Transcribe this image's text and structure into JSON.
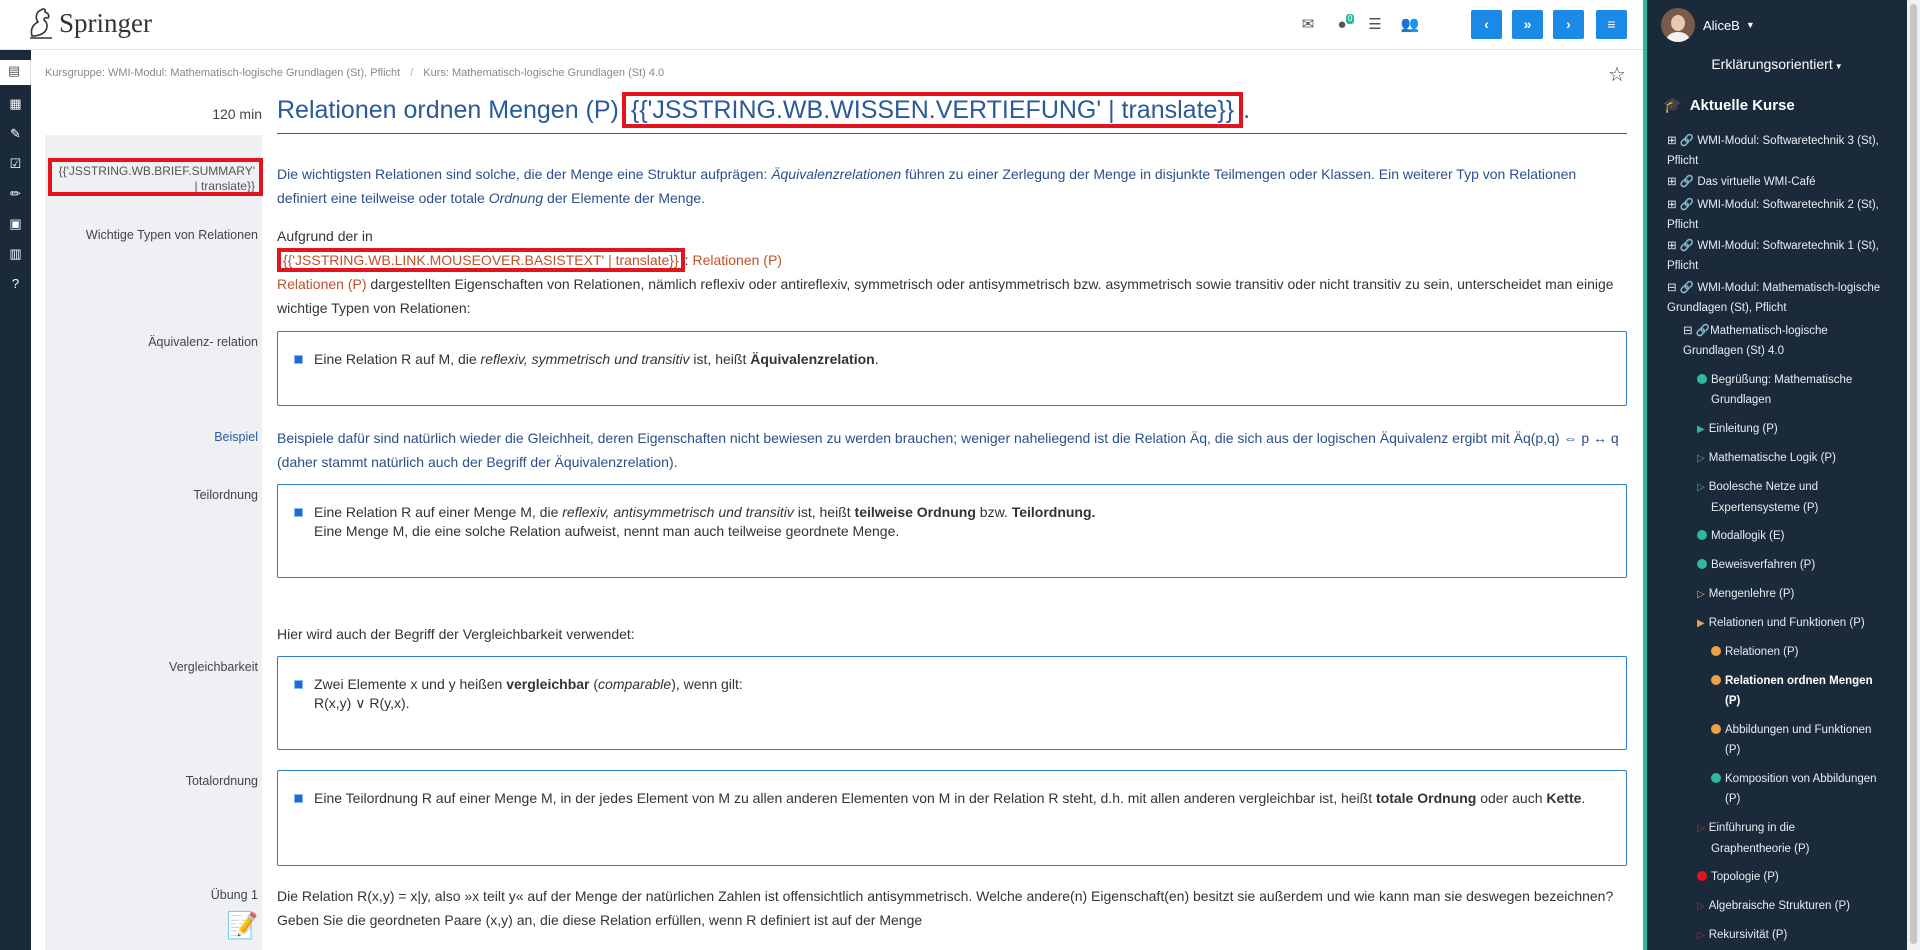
{
  "header": {
    "logo_text": "Springer",
    "badge_count": "0",
    "nav_prev": "‹",
    "nav_down": "»",
    "nav_next": "›",
    "nav_menu": "≡"
  },
  "breadcrumb": {
    "item1": "Kursgruppe: WMI-Modul: Mathematisch-logische Grundlagen (St), Pflicht",
    "item2": "Kurs: Mathematisch-logische Grundlagen (St) 4.0"
  },
  "page": {
    "duration": "120 min",
    "title": "Relationen ordnen Mengen (P)",
    "title_placeholder": "{{'JSSTRING.WB.WISSEN.VERTIEFUNG' | translate}}",
    "title_period": ".",
    "summary_placeholder": "{{'JSSTRING.WB.BRIEF.SUMMARY' | translate}}",
    "intro_a": "Die wichtigsten Relationen sind solche, die der Menge eine Struktur aufprägen: ",
    "intro_em1": "Äquivalenzrelationen",
    "intro_b": " führen zu einer Zerlegung der Menge in disjunkte Teilmengen oder Klassen. Ein weiterer Typ von Relationen definiert eine teilweise oder totale ",
    "intro_em2": "Ordnung",
    "intro_c": " der Elemente der Menge.",
    "types_prefix": "Aufgrund der in",
    "link_placeholder": "{{'JSSTRING.WB.LINK.MOUSEOVER.BASISTEXT' | translate}}",
    "link_colon": ":",
    "link_text": "Relationen (P)",
    "types_link2": "Relationen (P)",
    "types_rest": " dargestellten Eigenschaften von Relationen, nämlich reflexiv oder antireflexiv, symmetrisch oder antisymmetrisch bzw. asymmetrisch sowie transitiv oder nicht transitiv zu sein, unterscheidet man einige wichtige Typen von Relationen:",
    "aeq_a": "Eine Relation R auf M, die ",
    "aeq_em": "reflexiv, symmetrisch und transitiv",
    "aeq_b": " ist, heißt ",
    "aeq_strong": "Äquivalenzrelation",
    "aeq_c": ".",
    "example_text": "Beispiele dafür sind natürlich wieder die Gleichheit, deren Eigenschaften nicht bewiesen zu werden brauchen; weniger naheliegend ist die Relation Äq, die sich aus der logischen Äquivalenz ergibt mit Äq(p,q) ⇔ p ↔ q (daher stammt natürlich auch der Begriff der Äquivalenzrelation).",
    "teil_a": "Eine Relation R auf einer Menge M, die ",
    "teil_em": "reflexiv, antisymmetrisch und transitiv",
    "teil_b": " ist, heißt ",
    "teil_s1": "teilweise Ordnung",
    "teil_c": " bzw. ",
    "teil_s2": "Teilordnung.",
    "teil_line2": "Eine Menge M, die eine solche Relation aufweist, nennt man auch teilweise geordnete Menge.",
    "vergl_intro": "Hier wird auch der Begriff der Vergleichbarkeit verwendet:",
    "vergl_a": "Zwei Elemente x und y heißen ",
    "vergl_s": "vergleichbar",
    "vergl_b": " (",
    "vergl_em": "comparable",
    "vergl_c": "), wenn gilt:",
    "vergl_line2": "R(x,y) ∨ R(y,x).",
    "total_a": "Eine Teilordnung R auf einer Menge M, in der jedes Element von M zu allen anderen Elementen von M in der Relation R steht, d.h. mit allen anderen vergleichbar ist, heißt ",
    "total_s1": "totale Ordnung",
    "total_b": " oder auch ",
    "total_s2": "Kette",
    "total_c": ".",
    "uebung_text": "Die Relation R(x,y) = x|y, also »x teilt y« auf der Menge der natürlichen Zahlen ist offensichtlich antisymmetrisch. Welche andere(n) Eigenschaft(en) besitzt sie außerdem und wie kann man sie deswegen bezeichnen?",
    "uebung_line2": "Geben Sie die geordneten Paare (x,y) an, die diese Relation erfüllen, wenn R definiert ist auf der Menge"
  },
  "labels": {
    "types": "Wichtige Typen von Relationen",
    "aequivalenz": "Äquivalenz- relation",
    "beispiel": "Beispiel",
    "teilordnung": "Teilordnung",
    "vergleichbarkeit": "Vergleichbarkeit",
    "totalordnung": "Totalordnung",
    "uebung": "Übung 1"
  },
  "sidebar": {
    "username": "AliceB",
    "mode": "Erklärungsorientiert",
    "courses_heading": "Aktuelle Kurse",
    "c1a": "⊞ 🔗 WMI-Modul: Softwaretechnik 3 (St),",
    "c1b": "Pflicht",
    "c2": "⊞ 🔗 Das virtuelle WMI-Café",
    "c3a": "⊞ 🔗 WMI-Modul: Softwaretechnik 2 (St),",
    "c3b": "Pflicht",
    "c4a": "⊞ 🔗 WMI-Modul: Softwaretechnik 1 (St),",
    "c4b": "Pflicht",
    "c5a": "⊟ 🔗 WMI-Modul: Mathematisch-logische",
    "c5b": "Grundlagen (St), Pflicht",
    "c6a": "⊟ 🔗Mathematisch-logische",
    "c6b": "Grundlagen (St) 4.0",
    "l1a": "Begrüßung: Mathematische",
    "l1b": "Grundlagen",
    "l2": "Einleitung (P)",
    "l3": "Mathematische Logik (P)",
    "l4a": "Boolesche Netze und",
    "l4b": "Expertensysteme (P)",
    "l5": "Modallogik (E)",
    "l6": "Beweisverfahren (P)",
    "l7": "Mengenlehre (P)",
    "l8": "Relationen und Funktionen (P)",
    "s1": "Relationen (P)",
    "s2a": "Relationen ordnen Mengen",
    "s2b": "(P)",
    "s3a": "Abbildungen und Funktionen",
    "s3b": "(P)",
    "s4a": "Komposition von Abbildungen",
    "s4b": "(P)",
    "l9a": "Einführung in die",
    "l9b": "Graphentheorie (P)",
    "l10": "Topologie (P)",
    "l11": "Algebraische Strukturen (P)",
    "l12": "Rekursivität (P)"
  },
  "colors": {
    "accent": "#1a8ae6",
    "title_blue": "#2a5a9c",
    "teal": "#2eb8a0",
    "orange": "#e8a04a",
    "red": "#e4141c",
    "sidebar_bg": "#1b2a3b"
  }
}
